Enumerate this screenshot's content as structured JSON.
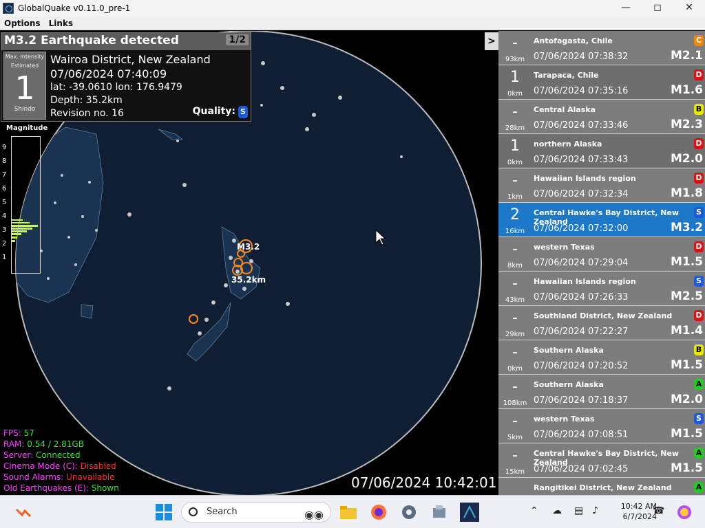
{
  "window": {
    "title": "GlobalQuake v0.11.0_pre-1"
  },
  "menu": [
    "Options",
    "Links"
  ],
  "quake_panel": {
    "header": "M3.2 Earthquake detected",
    "pager": "1/2",
    "intensity_label_1": "Max. Intensity",
    "intensity_label_2": "Estimated",
    "intensity_value": "1",
    "intensity_unit": "Shindo",
    "region": "Wairoa District, New Zealand",
    "datetime": "07/06/2024 07:40:09",
    "coords": "lat: -39.0610 lon: 176.9479",
    "depth": "Depth: 35.2km",
    "revision": "Revision no. 16",
    "quality_label": "Quality:",
    "quality_value": "S"
  },
  "magnitude_scale": {
    "title": "Magnitude",
    "ticks": [
      "9",
      "8",
      "7",
      "6",
      "5",
      "4",
      "3",
      "2",
      "1"
    ]
  },
  "map_labels": {
    "mag": "M3.2",
    "depth": "35.2km"
  },
  "expand_button": ">",
  "stats": [
    {
      "label": "FPS: ",
      "value": "57",
      "status": "ok"
    },
    {
      "label": "RAM: ",
      "value": "0.54 / 2.81GB",
      "status": "ok"
    },
    {
      "label": "Server: ",
      "value": "Connected",
      "status": "ok"
    },
    {
      "label": "Cinema Mode (C): ",
      "value": "Disabled",
      "status": "bad"
    },
    {
      "label": "Sound Alarms: ",
      "value": "Unavailable",
      "status": "bad"
    },
    {
      "label": "Old Earthquakes (E): ",
      "value": "Shown",
      "status": "ok"
    }
  ],
  "clock": "07/06/2024 10:42:01",
  "colors": {
    "badge_A": "#22cc22",
    "badge_B": "#e8e800",
    "badge_C": "#ee8800",
    "badge_D": "#dd1111",
    "badge_S": "#1c5ad8",
    "selected_row": "#1e78c8"
  },
  "quakes": [
    {
      "intensity": "-",
      "depth": "93km",
      "region": "Antofagasta, Chile",
      "time": "07/06/2024 07:38:32",
      "mag": "M2.1",
      "quality": "C",
      "bg": "#7d7d7d"
    },
    {
      "intensity": "1",
      "depth": "0km",
      "region": "Tarapaca, Chile",
      "time": "07/06/2024 07:35:16",
      "mag": "M1.6",
      "quality": "D",
      "bg": "#6e6e6e"
    },
    {
      "intensity": "-",
      "depth": "28km",
      "region": "Central Alaska",
      "time": "07/06/2024 07:33:46",
      "mag": "M2.3",
      "quality": "B",
      "bg": "#7d7d7d"
    },
    {
      "intensity": "1",
      "depth": "0km",
      "region": "northern Alaska",
      "time": "07/06/2024 07:33:43",
      "mag": "M2.0",
      "quality": "D",
      "bg": "#6e6e6e"
    },
    {
      "intensity": "-",
      "depth": "1km",
      "region": "Hawaiian Islands region",
      "time": "07/06/2024 07:32:34",
      "mag": "M1.8",
      "quality": "D",
      "bg": "#7d7d7d"
    },
    {
      "intensity": "2",
      "depth": "16km",
      "region": "Central Hawke's Bay District, New Zealand",
      "time": "07/06/2024 07:32:00",
      "mag": "M3.2",
      "quality": "S",
      "bg": "#1e78c8"
    },
    {
      "intensity": "-",
      "depth": "8km",
      "region": "western Texas",
      "time": "07/06/2024 07:29:04",
      "mag": "M1.5",
      "quality": "D",
      "bg": "#7d7d7d"
    },
    {
      "intensity": "-",
      "depth": "43km",
      "region": "Hawaiian Islands region",
      "time": "07/06/2024 07:26:33",
      "mag": "M2.5",
      "quality": "S",
      "bg": "#7d7d7d"
    },
    {
      "intensity": "-",
      "depth": "29km",
      "region": "Southland District, New Zealand",
      "time": "07/06/2024 07:22:27",
      "mag": "M1.4",
      "quality": "D",
      "bg": "#7d7d7d"
    },
    {
      "intensity": "-",
      "depth": "0km",
      "region": "Southern Alaska",
      "time": "07/06/2024 07:20:52",
      "mag": "M1.5",
      "quality": "B",
      "bg": "#7d7d7d"
    },
    {
      "intensity": "-",
      "depth": "108km",
      "region": "Southern Alaska",
      "time": "07/06/2024 07:18:37",
      "mag": "M2.0",
      "quality": "A",
      "bg": "#7d7d7d"
    },
    {
      "intensity": "-",
      "depth": "5km",
      "region": "western Texas",
      "time": "07/06/2024 07:08:51",
      "mag": "M1.5",
      "quality": "S",
      "bg": "#7d7d7d"
    },
    {
      "intensity": "-",
      "depth": "15km",
      "region": "Central Hawke's Bay District, New Zealand",
      "time": "07/06/2024 07:02:45",
      "mag": "M1.5",
      "quality": "A",
      "bg": "#7d7d7d"
    },
    {
      "intensity": "",
      "depth": "",
      "region": "Rangitikei District, New Zealand",
      "time": "",
      "mag": "",
      "quality": "A",
      "bg": "#7d7d7d"
    }
  ],
  "taskbar": {
    "search_placeholder": "Search",
    "time": "10:42 AM",
    "date": "6/7/2024"
  }
}
